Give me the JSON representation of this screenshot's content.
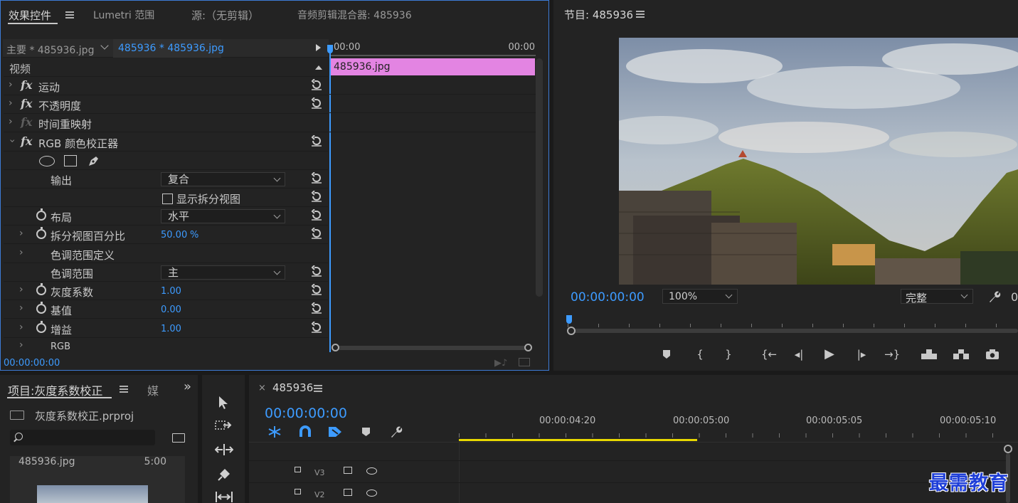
{
  "top_tabs": {
    "effects_controls": "效果控件",
    "lumetri_scopes": "Lumetri 范围",
    "source": "源:（无剪辑）",
    "audio_mixer": "音频剪辑混合器: 485936"
  },
  "effects_controls": {
    "master_clip": "主要 * 485936.jpg",
    "sequence_clip": "485936 * 485936.jpg",
    "ruler_start": "00:00",
    "ruler_end": "00:00",
    "clip_bar_label": "485936.jpg",
    "clip_bar_color": "#e384e2",
    "section_video": "视频",
    "effects": [
      {
        "label": "运动"
      },
      {
        "label": "不透明度"
      },
      {
        "label": "时间重映射"
      },
      {
        "label": "RGB 颜色校正器"
      }
    ],
    "output_label": "输出",
    "output_value": "复合",
    "show_split_view": "显示拆分视图",
    "layout_label": "布局",
    "layout_value": "水平",
    "split_percent_label": "拆分视图百分比",
    "split_percent_value": "50.00",
    "split_percent_unit": "%",
    "tonal_range_def": "色调范围定义",
    "tonal_range_label": "色调范围",
    "tonal_range_value": "主",
    "gamma_label": "灰度系数",
    "gamma_value": "1.00",
    "pedestal_label": "基值",
    "pedestal_value": "0.00",
    "gain_label": "增益",
    "gain_value": "1.00",
    "rgb_label": "RGB",
    "timecode": "00:00:00:00"
  },
  "program_monitor": {
    "title": "节目: 485936",
    "timecode": "00:00:00:00",
    "zoom": "100%",
    "quality": "完整",
    "right_cut": "0"
  },
  "project_panel": {
    "title": "项目:灰度系数校正",
    "tab2": "媒",
    "project_file": "灰度系数校正.prproj",
    "search_placeholder": "",
    "clip_name": "485936.jpg",
    "clip_duration": "5:00"
  },
  "timeline": {
    "sequence_name": "485936",
    "timecode": "00:00:00:00",
    "ruler_labels": [
      "00:00:04:20",
      "00:00:05:00",
      "00:00:05:05",
      "00:00:05:10"
    ],
    "tracks": [
      "V3",
      "V2"
    ],
    "work_area_color": "#e8d800"
  },
  "watermark": "最需教育",
  "accent_color": "#3d9bff"
}
